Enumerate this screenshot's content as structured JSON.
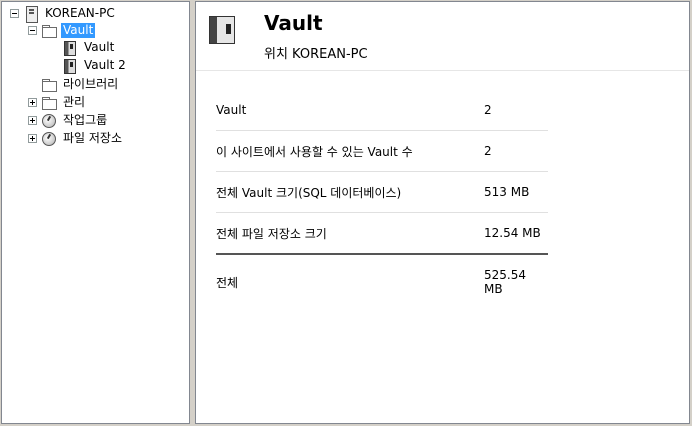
{
  "tree": {
    "root": "KOREAN-PC",
    "vault_folder": "Vault",
    "vaults": [
      "Vault",
      "Vault 2"
    ],
    "library": "라이브러리",
    "management": "관리",
    "workgroups": "작업그룹",
    "file_stores": "파일 저장소"
  },
  "detail": {
    "title": "Vault",
    "subtitle": "위치 KOREAN-PC",
    "rows": [
      {
        "label": "Vault",
        "value": "2"
      },
      {
        "label": "이 사이트에서 사용할 수 있는 Vault 수",
        "value": "2"
      },
      {
        "label": "전체 Vault 크기(SQL 데이터베이스)",
        "value": "513 MB"
      },
      {
        "label": "전체 파일 저장소 크기",
        "value": "12.54 MB"
      }
    ],
    "total": {
      "label": "전체",
      "value": "525.54 MB"
    }
  },
  "icons": {
    "pc": "computer-icon",
    "folder": "folder-icon",
    "vault": "vault-icon",
    "gauge": "gauge-icon"
  },
  "colors": {
    "selection": "#3399ff"
  }
}
